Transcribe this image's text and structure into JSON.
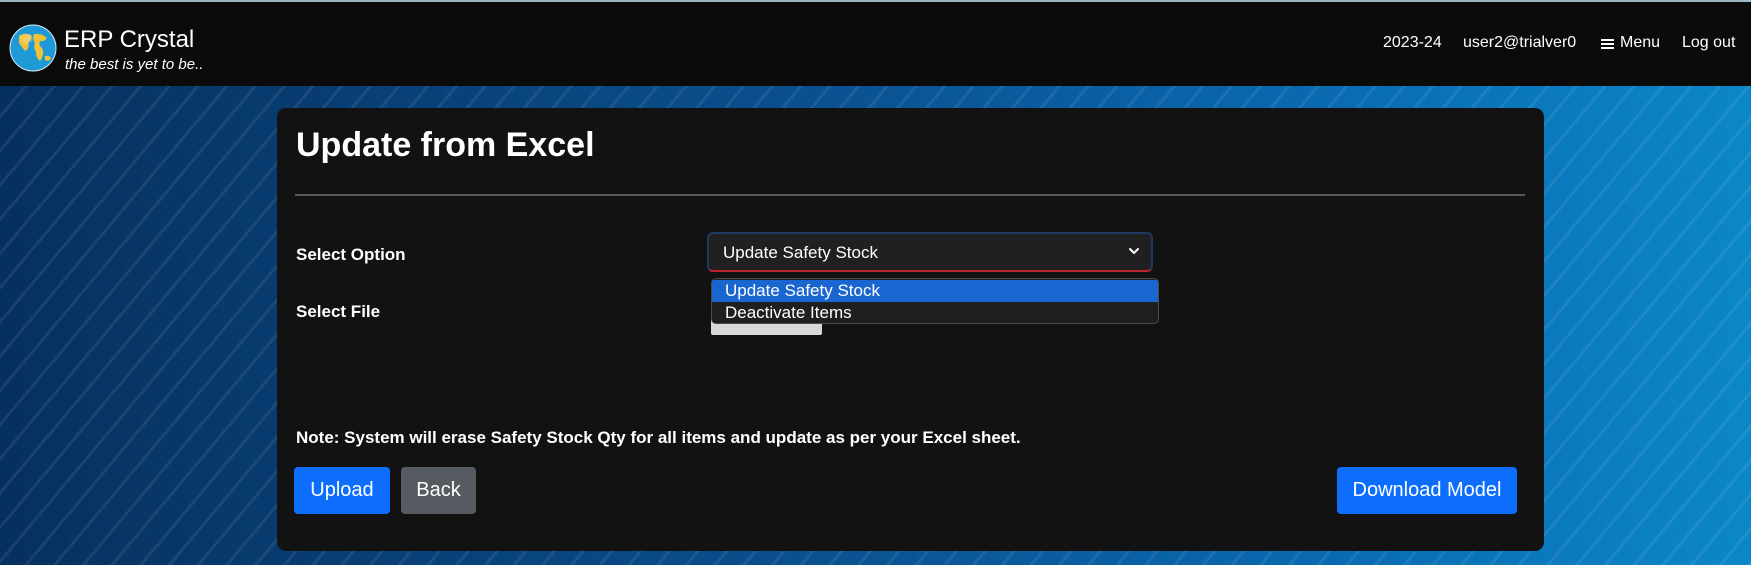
{
  "navbar": {
    "brand_title": "ERP Crystal",
    "brand_tagline": "the best is yet to be..",
    "logo_icon": "globe-icon",
    "fiscal_year": "2023-24",
    "user": "user2@trialver0",
    "menu_label": "Menu",
    "menu_icon": "hamburger-icon",
    "logout_label": "Log out"
  },
  "form": {
    "title": "Update from Excel",
    "select_option_label": "Select Option",
    "select_option_value": "Update Safety Stock",
    "select_options": [
      "Update Safety Stock",
      "Deactivate Items"
    ],
    "select_file_label": "Select File",
    "note": "Note: System will erase Safety Stock Qty for all items and update as per your Excel sheet."
  },
  "buttons": {
    "upload": "Upload",
    "back": "Back",
    "download_model": "Download Model"
  },
  "colors": {
    "navbar_bg": "#0b0b0b",
    "card_bg": "#121212",
    "primary": "#0d6efd",
    "secondary": "#555b61",
    "dropdown_highlight": "#1a66d1"
  }
}
